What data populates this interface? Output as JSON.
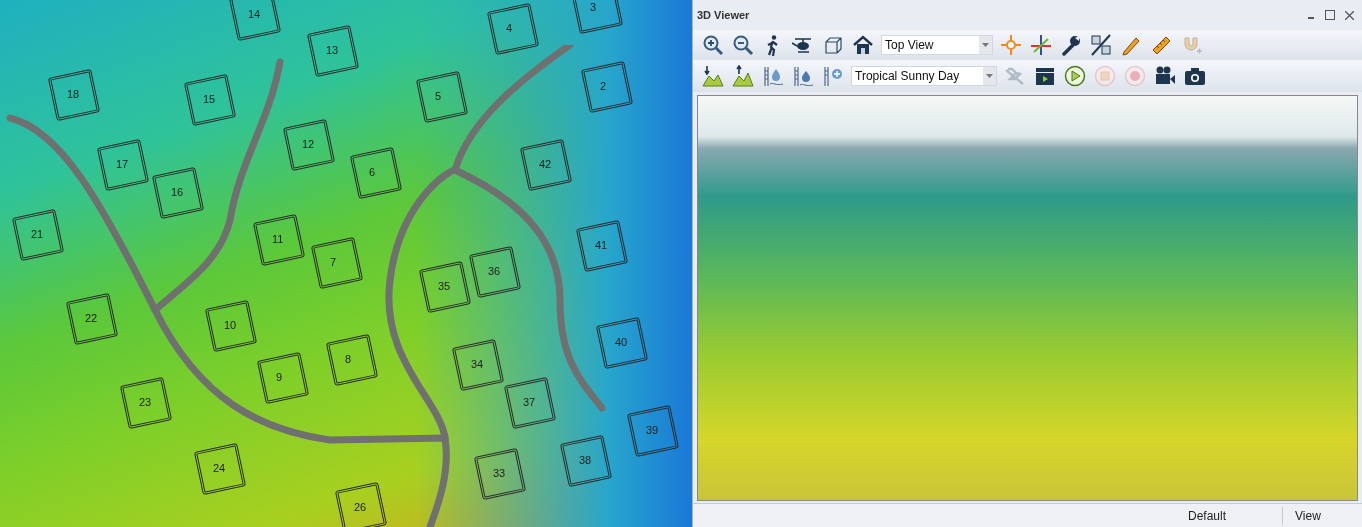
{
  "map": {
    "lots": [
      "14",
      "4",
      "3",
      "13",
      "18",
      "15",
      "5",
      "2",
      "12",
      "6",
      "42",
      "17",
      "16",
      "21",
      "11",
      "7",
      "36",
      "35",
      "41",
      "22",
      "10",
      "8",
      "9",
      "34",
      "40",
      "23",
      "37",
      "39",
      "24",
      "33",
      "38",
      "26"
    ]
  },
  "viewer": {
    "title": "3D Viewer",
    "toolbar_rows": [
      [
        {
          "kind": "icon",
          "disabled": false
        },
        {
          "kind": "icon",
          "disabled": false
        },
        {
          "kind": "icon",
          "disabled": false
        },
        {
          "kind": "icon",
          "disabled": false
        },
        {
          "kind": "icon",
          "disabled": false
        },
        {
          "kind": "icon",
          "disabled": false
        },
        {
          "kind": "dropdown",
          "value": "Top View"
        },
        {
          "kind": "icon",
          "disabled": false
        },
        {
          "kind": "icon",
          "disabled": false
        },
        {
          "kind": "icon",
          "disabled": false
        },
        {
          "kind": "icon",
          "disabled": false
        },
        {
          "kind": "icon",
          "disabled": false
        },
        {
          "kind": "icon",
          "disabled": false
        },
        {
          "kind": "icon",
          "disabled": true
        }
      ],
      [
        {
          "kind": "icon",
          "disabled": false
        },
        {
          "kind": "icon",
          "disabled": false
        },
        {
          "kind": "icon",
          "disabled": false
        },
        {
          "kind": "icon",
          "disabled": false
        },
        {
          "kind": "icon",
          "disabled": false
        },
        {
          "kind": "dropdown",
          "value": "Tropical Sunny Day"
        },
        {
          "kind": "icon",
          "disabled": true
        },
        {
          "kind": "icon",
          "disabled": false
        },
        {
          "kind": "icon",
          "disabled": false
        },
        {
          "kind": "icon",
          "disabled": true
        },
        {
          "kind": "icon",
          "disabled": true
        },
        {
          "kind": "icon",
          "disabled": false
        },
        {
          "kind": "icon",
          "disabled": false
        }
      ]
    ],
    "status_bar": [
      "Default",
      "View"
    ]
  }
}
